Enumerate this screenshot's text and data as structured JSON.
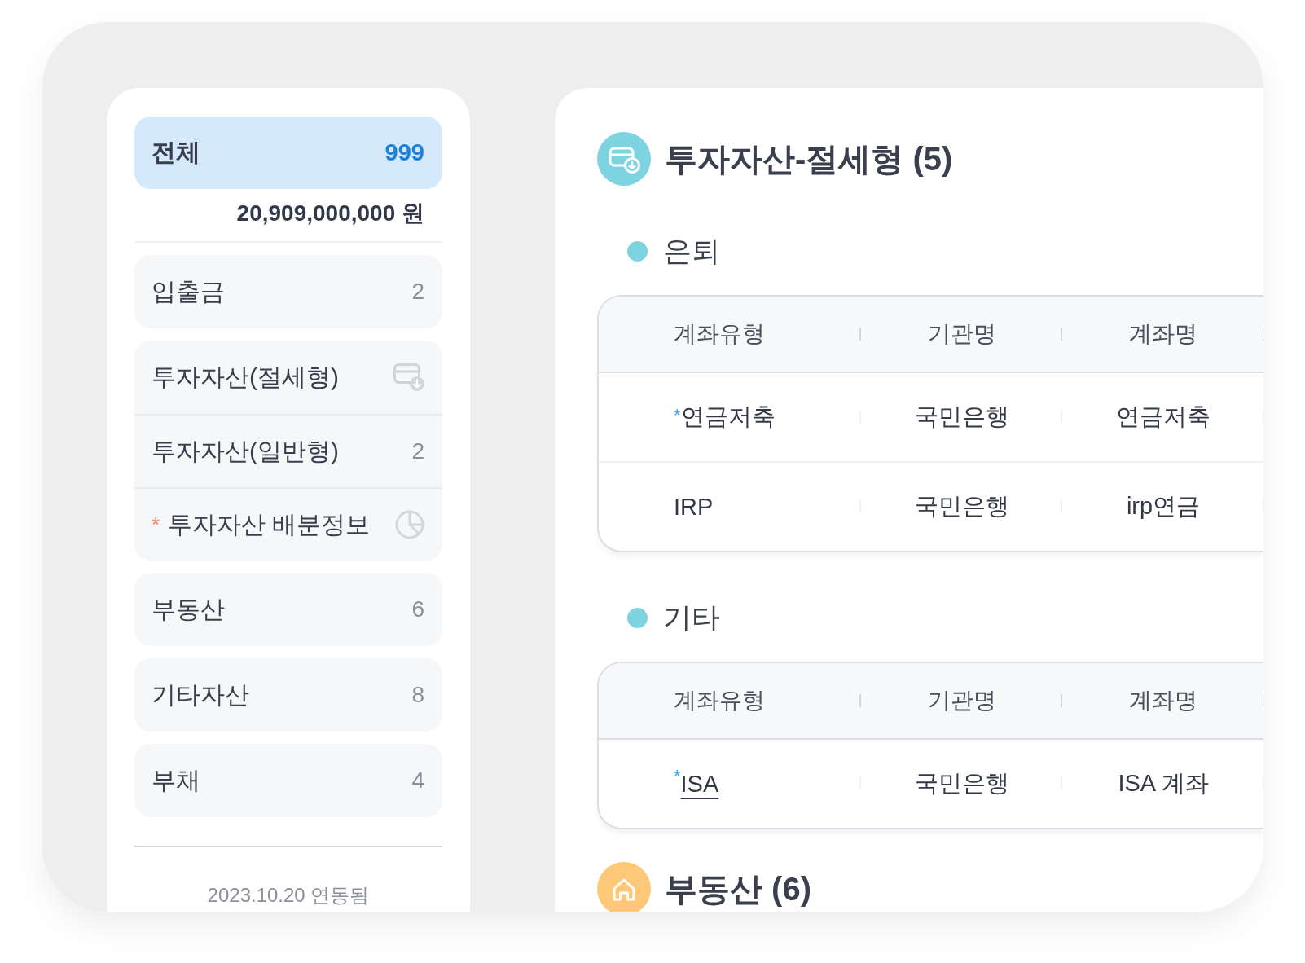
{
  "sidebar": {
    "total": {
      "label": "전체",
      "count": "999",
      "selected": true
    },
    "total_amount": "20,909,000,000 원",
    "groups": [
      {
        "items": [
          {
            "kind": "count",
            "label": "입출금",
            "count": "2",
            "selected": false
          }
        ]
      },
      {
        "items": [
          {
            "kind": "account",
            "label": "투자자산(절세형)",
            "selected": false
          },
          {
            "kind": "count",
            "label": "투자자산(일반형)",
            "count": "2",
            "selected": false
          },
          {
            "kind": "allocation",
            "label": "투자자산 배분정보",
            "required_mark": "*",
            "selected": false
          }
        ]
      },
      {
        "items": [
          {
            "kind": "count",
            "label": "부동산",
            "count": "6",
            "selected": false
          }
        ]
      },
      {
        "items": [
          {
            "kind": "count",
            "label": "기타자산",
            "count": "8",
            "selected": false
          }
        ]
      },
      {
        "items": [
          {
            "kind": "count",
            "label": "부채",
            "count": "4",
            "selected": false
          }
        ]
      }
    ],
    "sync_status": "2023.10.20 연동됨"
  },
  "content": {
    "sections": [
      {
        "kind": "investment",
        "color": "#7dd4e0",
        "title": "투자자산-절세형 (5)",
        "groups": [
          {
            "title": "은퇴",
            "columns": [
              "계좌유형",
              "기관명",
              "계좌명"
            ],
            "rows": [
              [
                {
                  "text": "$^{*}$연금저축",
                  "link": false
                },
                {
                  "text": "국민은행",
                  "link": false
                },
                {
                  "text": "연금저축",
                  "link": false
                }
              ],
              [
                {
                  "text": "IRP",
                  "link": false
                },
                {
                  "text": "국민은행",
                  "link": false
                },
                {
                  "text": "irp연금",
                  "link": false
                }
              ]
            ]
          },
          {
            "title": "기타",
            "columns": [
              "계좌유형",
              "기관명",
              "계좌명"
            ],
            "rows": [
              [
                {
                  "text": "$^{*}$ISA",
                  "link": true
                },
                {
                  "text": "국민은행",
                  "link": false
                },
                {
                  "text": "ISA 계좌",
                  "link": false
                }
              ]
            ]
          }
        ]
      },
      {
        "kind": "real_estate",
        "color": "#ffc878",
        "title": "부동산 (6)"
      }
    ]
  }
}
